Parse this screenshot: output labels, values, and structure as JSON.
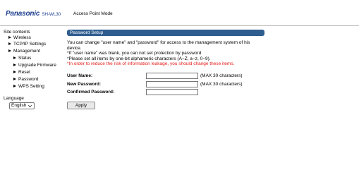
{
  "header": {
    "brand": "Panasonic",
    "model": "SH-WL30",
    "mode": "Access Point Mode"
  },
  "sidebar": {
    "title": "Site contents",
    "items": [
      {
        "label": "Wireless",
        "level": 1
      },
      {
        "label": "TCP/IP Settings",
        "level": 1
      },
      {
        "label": "Management",
        "level": 1
      },
      {
        "label": "Status",
        "level": 2
      },
      {
        "label": "Upgrade Firmware",
        "level": 2
      },
      {
        "label": "Reset",
        "level": 2
      },
      {
        "label": "Password",
        "level": 2
      },
      {
        "label": "WPS Setting",
        "level": 2
      }
    ],
    "language_label": "Language",
    "language_value": "English"
  },
  "panel": {
    "title": "Password Setup",
    "description_lines": [
      "You can change \"user name\" and \"password\" for access to the management system of his device.",
      "*If \"user name\" was blank, you can not set protection by password",
      "*Please set all items by one-bit alphameric characters (A~Z, a~z, 0~9)."
    ],
    "warning": "*In order to reduce the risk of information leakage, you should change these items.",
    "fields": [
      {
        "label": "User Name:",
        "value": "",
        "hint": "(MAX 30 characters)"
      },
      {
        "label": "New Password:",
        "value": "",
        "hint": "(MAX 30 characters)"
      },
      {
        "label": "Confirmed Password:",
        "value": "",
        "hint": ""
      }
    ],
    "apply_label": "Apply"
  },
  "colors": {
    "brand": "#1e3f8f",
    "panel_header": "#2f5d90",
    "warning": "#e41b17"
  }
}
